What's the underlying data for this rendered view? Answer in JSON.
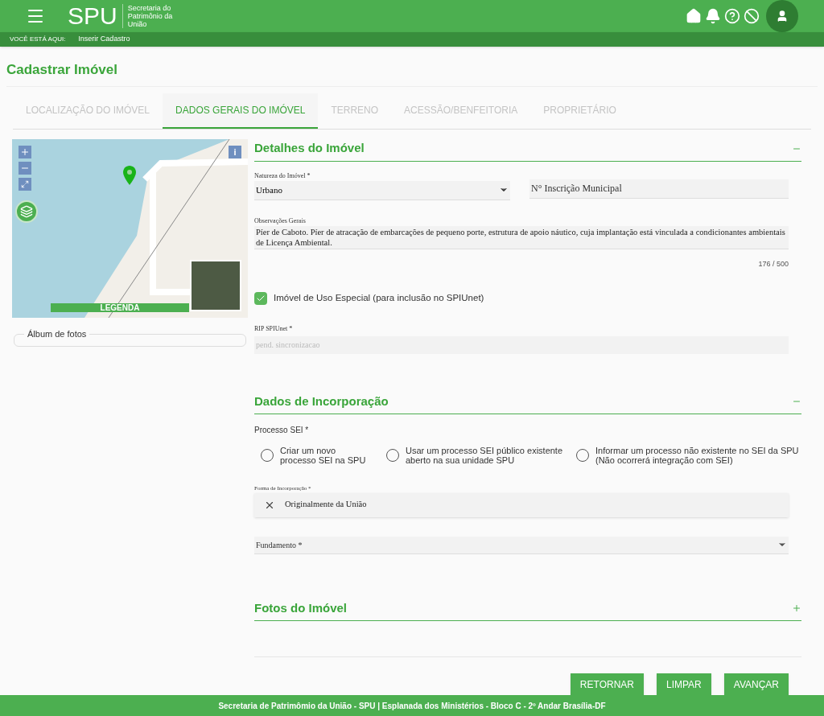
{
  "header": {
    "logo": "SPU",
    "logo_subtitle": "Secretaria do Patrimônio da União"
  },
  "breadcrumb": {
    "label": "VOCÊ ESTÁ AQUI:",
    "current": "Inserir Cadastro"
  },
  "page_title": "Cadastrar Imóvel",
  "tabs": [
    {
      "label": "LOCALIZAÇÃO DO IMÓVEL",
      "selected": false
    },
    {
      "label": "DADOS GERAIS DO IMÓVEL",
      "selected": true
    },
    {
      "label": "TERRENO",
      "selected": false
    },
    {
      "label": "ACESSÃO/BENFEITORIA",
      "selected": false
    },
    {
      "label": "PROPRIETÁRIO",
      "selected": false
    }
  ],
  "map": {
    "info_button": "i",
    "legend_button": "LEGENDA"
  },
  "album": {
    "legend": "Álbum de fotos"
  },
  "details": {
    "title": "Detalhes do Imóvel",
    "expanded": true,
    "natureza": {
      "label": "Natureza do Imóvel *",
      "value": "Urbano"
    },
    "inscricao": {
      "placeholder": "N° Inscrição Municipal"
    },
    "observacoes": {
      "label": "Observações Gerais",
      "value": "Píer de Caboto. Píer de atracação de embarcações de pequeno porte, estrutura de apoio náutico, cuja implantação está vinculada a condicionantes ambientais de Licença Ambiental.",
      "counter": "176 / 500"
    },
    "uso_especial": {
      "label": "Imóvel de Uso Especial (para inclusão no SPIUnet)",
      "checked": true
    },
    "rip": {
      "label": "RIP SPIUnet *",
      "placeholder": "pend. sincronizacao"
    }
  },
  "incorporacao": {
    "title": "Dados de Incorporação",
    "expanded": true,
    "processo_label": "Processo SEI *",
    "processo_options": [
      {
        "label": "Criar um novo processo SEI na SPU",
        "selected": false
      },
      {
        "label": "Usar um processo SEI público existente aberto na sua unidade SPU",
        "selected": false
      },
      {
        "label": "Informar um processo não existente no SEI da SPU (Não ocorrerá integração com SEI)",
        "selected": false
      }
    ],
    "forma": {
      "label": "Forma de Incorporação *",
      "value": "Originalmente da União"
    },
    "fundamento": {
      "placeholder": "Fundamento *"
    }
  },
  "fotos": {
    "title": "Fotos do Imóvel",
    "expanded": false
  },
  "buttons": [
    "RETORNAR",
    "LIMPAR",
    "AVANÇAR"
  ],
  "footer": "Secretaria de Patrimômio da União - SPU | Esplanada dos Ministérios - Bloco C - 2º Andar Brasília-DF"
}
